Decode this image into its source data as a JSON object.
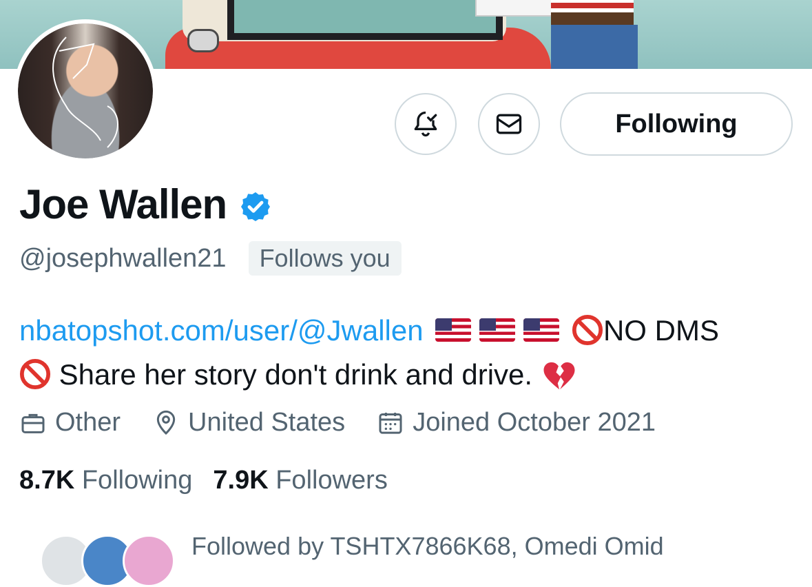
{
  "profile": {
    "display_name": "Joe Wallen",
    "handle": "@josephwallen21",
    "follows_you_badge": "Follows you",
    "verified_icon": "verified-badge-icon"
  },
  "actions": {
    "notify_icon": "bell-check-icon",
    "message_icon": "mail-icon",
    "follow_button_label": "Following"
  },
  "bio": {
    "link": "nbatopshot.com/user/@Jwallen",
    "after_flags": "NO DMS",
    "line2": "Share her story don't drink and drive."
  },
  "meta": {
    "category": "Other",
    "location": "United States",
    "joined": "Joined October 2021"
  },
  "stats": {
    "following_count": "8.7K",
    "following_label": "Following",
    "followers_count": "7.9K",
    "followers_label": "Followers"
  },
  "followed_by": {
    "text": "Followed by TSHTX7866K68, Omedi Omid"
  },
  "colors": {
    "accent": "#1d9bf0",
    "muted_text": "#536471",
    "border": "#cfd9de"
  }
}
